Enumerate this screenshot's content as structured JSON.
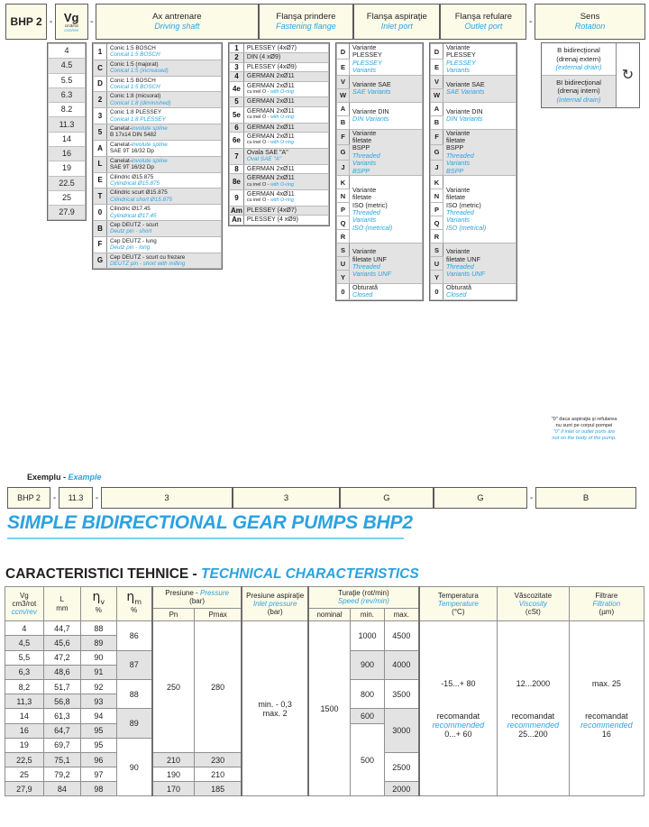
{
  "header": {
    "model": "BHP 2",
    "vg": {
      "symbol": "Vg",
      "unit_ro": "cm3/rot",
      "unit_en": "ccm/rev"
    },
    "driving_shaft": {
      "ro": "Ax antrenare",
      "en": "Driving shaft"
    },
    "fastening_flange": {
      "ro": "Flanşa prindere",
      "en": "Fastening flange"
    },
    "inlet_port": {
      "ro": "Flanşa aspiraţie",
      "en": "Inlet port"
    },
    "outlet_port": {
      "ro": "Flanşa refulare",
      "en": "Outlet port"
    },
    "rotation": {
      "ro": "Sens",
      "en": "Rotation"
    },
    "dash": "-"
  },
  "vg_values": [
    "4",
    "4.5",
    "5.5",
    "6.3",
    "8.2",
    "11.3",
    "14",
    "16",
    "19",
    "22.5",
    "25",
    "27.9"
  ],
  "driving_shaft_options": [
    {
      "code": "1",
      "ro": "Conic 1:5   BOSCH",
      "en": "Conical 1:5 BOSCH"
    },
    {
      "code": "C",
      "ro": "Conic 1:5  (majorat)",
      "en": "Conical 1:5 (increased)"
    },
    {
      "code": "D",
      "ro": "Conic 1:5   BOSCH",
      "en": "Conical 1:5 BOSCH"
    },
    {
      "code": "2",
      "ro": "Conic 1:8  (micsorat)",
      "en": "Conical 1:8 (diminished)"
    },
    {
      "code": "3",
      "ro": "Conic 1:8  PLESSEY",
      "en": "Conical 1:8 PLESSEY"
    },
    {
      "code": "5",
      "ro": "Canelat-",
      "en": "involute spline",
      "ro2": "B 17x14   DIN 5482"
    },
    {
      "code": "A",
      "ro": "Canelat-",
      "en": "involute spline",
      "ro2": "SAE  9T 16/32 Dp"
    },
    {
      "code": "L",
      "ro": "Canelat-",
      "en": "involute spline",
      "ro2": "SAE  9T 16/32 Dp"
    },
    {
      "code": "E",
      "ro": "Cilindric     Ø15.875",
      "en": "Cylindrical  Ø15.875"
    },
    {
      "code": "T",
      "ro": "Cilindric scurt Ø15.875",
      "en": "Cilindrical short Ø15.875"
    },
    {
      "code": "0",
      "ro": "Cilindric    Ø17.45",
      "en": "Cylindrical  Ø17.45"
    },
    {
      "code": "B",
      "ro": "Cep DEUTZ - scurt",
      "en": "Deutz pin - short"
    },
    {
      "code": "F",
      "ro": "Cep DEUTZ - lung",
      "en": "Deutz pin - long"
    },
    {
      "code": "G",
      "ro": "Cep DEUTZ - scurt cu frezare",
      "en": "DEUTZ pin - short with milling"
    }
  ],
  "fastening_flange_options": [
    {
      "code": "1",
      "ro": "PLESSEY (4xØ7)",
      "en": ""
    },
    {
      "code": "2",
      "ro": "DIN   (4 xØ9)",
      "en": ""
    },
    {
      "code": "3",
      "ro": "PLESSEY (4xØ9)",
      "en": ""
    },
    {
      "code": "4",
      "ro": "GERMAN  2xØ11",
      "en": ""
    },
    {
      "code": "4e",
      "ro": "GERMAN  2xØ11",
      "sub_ro": "cu inel O - ",
      "sub_en": "with O-ring"
    },
    {
      "code": "5",
      "ro": "GERMAN  2xØ11",
      "en": ""
    },
    {
      "code": "5e",
      "ro": "GERMAN  2xØ11",
      "sub_ro": "cu inel O - ",
      "sub_en": "with O-ring"
    },
    {
      "code": "6",
      "ro": "GERMAN  2xØ11",
      "en": ""
    },
    {
      "code": "6e",
      "ro": "GERMAN  2xØ11",
      "sub_ro": "cu inel O - ",
      "sub_en": "with O-ring"
    },
    {
      "code": "7",
      "ro": "Ovala SAE \"A\"",
      "en": "Oval  SAE \"A\""
    },
    {
      "code": "8",
      "ro": "GERMAN  2xØ11",
      "en": ""
    },
    {
      "code": "8e",
      "ro": "GERMAN  2xØ11",
      "sub_ro": "cu inel O - ",
      "sub_en": "with O-ring"
    },
    {
      "code": "9",
      "ro": "GERMAN  4xØ11",
      "sub_ro": "cu inel O - ",
      "sub_en": "with O-ring"
    },
    {
      "code": "Am",
      "ro": "PLESSEY (4xØ7)",
      "en": ""
    },
    {
      "code": "An",
      "ro": "PLESSEY (4 xØ9)",
      "en": ""
    }
  ],
  "port_options": [
    {
      "codes": [
        "D",
        "E"
      ],
      "ro": "Variante\nPLESSEY",
      "en": "PLESSEY\nVariants",
      "shaded": false
    },
    {
      "codes": [
        "V",
        "W"
      ],
      "ro": "Variante SAE",
      "en": "SAE Variants",
      "shaded": true
    },
    {
      "codes": [
        "A",
        "B"
      ],
      "ro": "Variante DIN",
      "en": "DIN Variants",
      "shaded": false
    },
    {
      "codes": [
        "F",
        "G",
        "J"
      ],
      "ro": "Variante\nfiletate\nBSPP",
      "en": "Threaded\nVariants\nBSPP",
      "shaded": true
    },
    {
      "codes": [
        "K",
        "N",
        "P",
        "Q",
        "R"
      ],
      "ro": "Variante\nfiletate\nISO (metric)",
      "en": "Threaded\nVariants\nISO (metrical)",
      "shaded": false
    },
    {
      "codes": [
        "S",
        "U",
        "Y"
      ],
      "ro": "Variante\nfiletate UNF",
      "en": "Threaded\nVariants UNF",
      "shaded": true
    },
    {
      "codes": [
        "0"
      ],
      "ro": "Obturată",
      "en": "Closed",
      "shaded": false
    }
  ],
  "rotation_options": [
    {
      "ro_line1": "B bidirecţional",
      "ro_line2": "(drenaj extern)",
      "en": "(external drain)",
      "shaded": false
    },
    {
      "ro_line1": "BI bidirecţional",
      "ro_line2": "(drenaj intern)",
      "en": "(internal drain)",
      "shaded": true
    }
  ],
  "rotation_icon": "↻",
  "note": {
    "ro_line1": "\"0\" daca aspiraţia şi refularea",
    "ro_line2": "nu sunt pe corpul pompei",
    "en_line1": "\"0\" if inlet or outlet ports are",
    "en_line2": "not on the body of the pump."
  },
  "example": {
    "label_ro": "Exemplu -",
    "label_en": "Example",
    "values": [
      "BHP 2",
      "11.3",
      "3",
      "3",
      "G",
      "G",
      "B"
    ],
    "dash": "-"
  },
  "title": "SIMPLE BIDIRECTIONAL GEAR PUMPS BHP2",
  "section_title_ro": "CARACTERISTICI TEHNICE -",
  "section_title_en": "TECHNICAL CHARACTERISTICS",
  "chart_data": {
    "type": "table",
    "title": "CARACTERISTICI TEHNICE - TECHNICAL CHARACTERISTICS",
    "columns": [
      {
        "ro": "Vg",
        "sub_ro": "cm3/rot",
        "sub_en": "ccm/rev"
      },
      {
        "ro": "L",
        "sub_ro": "mm"
      },
      {
        "ro": "ηv",
        "sub_ro": "%"
      },
      {
        "ro": "ηm",
        "sub_ro": "%"
      },
      {
        "ro": "Presiune -",
        "en": "Pressure",
        "unit": "(bar)",
        "children": [
          "Pn",
          "Pmax"
        ]
      },
      {
        "ro": "Presiune aspiraţie",
        "en": "Inlet pressure",
        "unit": "(bar)"
      },
      {
        "ro": "Turaţie (rot/min)",
        "en": "Speed (rev/min)",
        "children": [
          "nominal",
          "min.",
          "max."
        ]
      },
      {
        "ro": "Temperatura",
        "en": "Temperature",
        "unit": "(°C)"
      },
      {
        "ro": "Văscozitate",
        "en": "Viscosity",
        "unit": "(cSt)"
      },
      {
        "ro": "Filtrare",
        "en": "Filtration",
        "unit": "(µm)"
      }
    ],
    "rows": [
      {
        "vg": "4",
        "L": "44,7",
        "nv": "88"
      },
      {
        "vg": "4,5",
        "L": "45,6",
        "nv": "89"
      },
      {
        "vg": "5,5",
        "L": "47,2",
        "nv": "90"
      },
      {
        "vg": "6,3",
        "L": "48,6",
        "nv": "91"
      },
      {
        "vg": "8,2",
        "L": "51,7",
        "nv": "92"
      },
      {
        "vg": "11,3",
        "L": "56,8",
        "nv": "93"
      },
      {
        "vg": "14",
        "L": "61,3",
        "nv": "94"
      },
      {
        "vg": "16",
        "L": "64,7",
        "nv": "95"
      },
      {
        "vg": "19",
        "L": "69,7",
        "nv": "95"
      },
      {
        "vg": "22,5",
        "L": "75,1",
        "nv": "96"
      },
      {
        "vg": "25",
        "L": "79,2",
        "nv": "97"
      },
      {
        "vg": "27,9",
        "L": "84",
        "nv": "98"
      }
    ],
    "nm_groups": [
      {
        "value": "86",
        "span": 2
      },
      {
        "value": "87",
        "span": 2
      },
      {
        "value": "88",
        "span": 2
      },
      {
        "value": "89",
        "span": 2
      },
      {
        "value": "90",
        "span": 4
      }
    ],
    "pn": [
      {
        "value": "250",
        "span": 9
      },
      {
        "value": "210",
        "span": 1
      },
      {
        "value": "190",
        "span": 1
      },
      {
        "value": "170",
        "span": 1
      }
    ],
    "pmax": [
      {
        "value": "280",
        "span": 9
      },
      {
        "value": "230",
        "span": 1
      },
      {
        "value": "210",
        "span": 1
      },
      {
        "value": "185",
        "span": 1
      }
    ],
    "inlet_pressure": "min. - 0,3\nmax. 2",
    "inlet_pressure_line1": "min. - 0,3",
    "inlet_pressure_line2": "max. 2",
    "speed_nominal": "1500",
    "speed_min": [
      {
        "value": "1000",
        "span": 2
      },
      {
        "value": "900",
        "span": 2
      },
      {
        "value": "800",
        "span": 2
      },
      {
        "value": "600",
        "span": 1
      },
      {
        "value": "500",
        "span": 5
      }
    ],
    "speed_max": [
      {
        "value": "4500",
        "span": 2
      },
      {
        "value": "4000",
        "span": 2
      },
      {
        "value": "3500",
        "span": 2
      },
      {
        "value": "3000",
        "span": 3
      },
      {
        "value": "2500",
        "span": 2
      },
      {
        "value": "2000",
        "span": 1
      }
    ],
    "temperature": {
      "range": "-15...+ 80",
      "rec_ro": "recomandat",
      "rec_en": "recommended",
      "rec_value": "0...+ 60"
    },
    "viscosity": {
      "range": "12...2000",
      "rec_ro": "recomandat",
      "rec_en": "recommended",
      "rec_value": "25...200"
    },
    "filtration": {
      "range": "max. 25",
      "rec_ro": "recomandat",
      "rec_en": "recommended",
      "rec_value": "16"
    }
  }
}
